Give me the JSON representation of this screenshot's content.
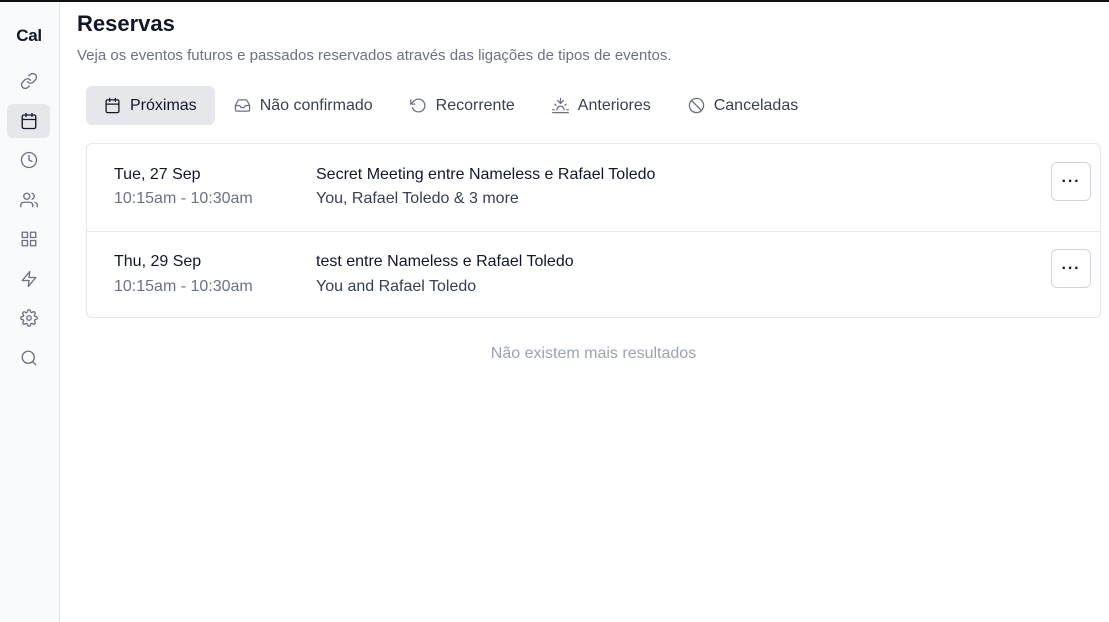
{
  "app": {
    "logo": "Cal"
  },
  "sidebar": {
    "items": [
      {
        "name": "event-types",
        "icon": "link-icon"
      },
      {
        "name": "bookings",
        "icon": "calendar-icon",
        "active": true
      },
      {
        "name": "availability",
        "icon": "clock-icon"
      },
      {
        "name": "teams",
        "icon": "users-icon"
      },
      {
        "name": "apps",
        "icon": "grid-icon"
      },
      {
        "name": "workflows",
        "icon": "zap-icon"
      },
      {
        "name": "settings",
        "icon": "gear-icon"
      },
      {
        "name": "search",
        "icon": "search-icon"
      }
    ]
  },
  "header": {
    "title": "Reservas",
    "subtitle": "Veja os eventos futuros e passados reservados através das ligações de tipos de eventos."
  },
  "tabs": [
    {
      "label": "Próximas",
      "icon": "calendar-icon",
      "active": true
    },
    {
      "label": "Não confirmado",
      "icon": "inbox-icon"
    },
    {
      "label": "Recorrente",
      "icon": "rotate-ccw-icon"
    },
    {
      "label": "Anteriores",
      "icon": "sunset-icon"
    },
    {
      "label": "Canceladas",
      "icon": "slash-circle-icon"
    }
  ],
  "bookings": [
    {
      "date": "Tue, 27 Sep",
      "time": "10:15am - 10:30am",
      "title": "Secret Meeting entre Nameless e Rafael Toledo",
      "attendees": "You, Rafael Toledo & 3 more",
      "menu_label": "···"
    },
    {
      "date": "Thu, 29 Sep",
      "time": "10:15am - 10:30am",
      "title": "test entre Nameless e Rafael Toledo",
      "attendees": "You and Rafael Toledo",
      "menu_label": "···"
    }
  ],
  "footer": {
    "no_more": "Não existem mais resultados"
  },
  "colors": {
    "active_bg": "#e5e7eb",
    "text_primary": "#111827",
    "text_muted": "#6b7280",
    "border": "#e5e7eb"
  }
}
